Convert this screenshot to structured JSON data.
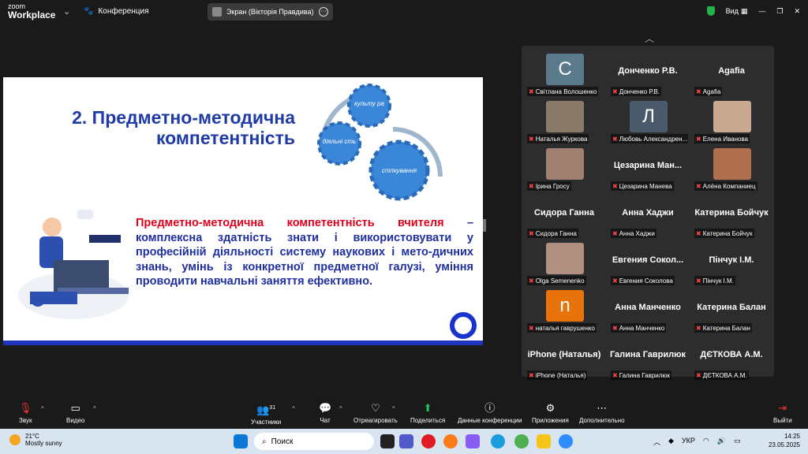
{
  "topbar": {
    "brand_small": "zoom",
    "brand_big": "Workplace",
    "conference": "Конференция",
    "screen_title": "Экран (Вікторія Правдива)",
    "view": "Вид"
  },
  "slide": {
    "title1": "2. Предметно-методична",
    "title2": "компетентність",
    "gear1": "культу ра",
    "gear2": "діяльні сть",
    "gear3": "спілкування",
    "def_red": "Предметно-методична компетентність вчителя",
    "def_rest": " – комплексна здатність знати і використовувати у професійній діяльності систему наукових і мето-дичних знань, умінь із конкретної предметної галузі, уміння проводити навчальні заняття ефективно."
  },
  "participants": [
    {
      "big": "",
      "name": "Світлана Волошенко",
      "avatar": "С",
      "color": "#5b7a8c"
    },
    {
      "big": "Донченко Р.В.",
      "name": "Донченко Р.В."
    },
    {
      "big": "Agafia",
      "name": "Agafia"
    },
    {
      "big": "",
      "name": "Наталья Журкова",
      "photo": "#8a7a6a"
    },
    {
      "big": "",
      "name": "Любовь Александрен...",
      "avatar": "Л",
      "color": "#4a5a6a"
    },
    {
      "big": "",
      "name": "Елена Иванова",
      "photo": "#c8a890"
    },
    {
      "big": "",
      "name": "Ірина Гросу",
      "photo": "#a08070"
    },
    {
      "big": "Цезарина Ман...",
      "name": "Цезарина Манева"
    },
    {
      "big": "",
      "name": "Алёна Компаниец",
      "photo": "#b07050"
    },
    {
      "big": "Сидора Ганна",
      "name": "Сидора Ганна"
    },
    {
      "big": "Анна Хаджи",
      "name": "Анна Хаджи"
    },
    {
      "big": "Катерина Бойчук",
      "name": "Катерина Бойчук"
    },
    {
      "big": "",
      "name": "Olga Semenenko",
      "photo": "#b09080"
    },
    {
      "big": "Евгения Сокол...",
      "name": "Евгения Соколова"
    },
    {
      "big": "Пінчук І.М.",
      "name": "Пінчук І.М."
    },
    {
      "big": "",
      "name": "наталья гаврушенко",
      "avatar": "n",
      "color": "#e8720c"
    },
    {
      "big": "Анна Манченко",
      "name": "Анна Манченко"
    },
    {
      "big": "Катерина Балан",
      "name": "Катерина Балан"
    },
    {
      "big": "iPhone (Наталья)",
      "name": "iPhone (Наталья)"
    },
    {
      "big": "Галина Гаврилюк",
      "name": "Галина Гаврилюк"
    },
    {
      "big": "ДЄТКОВА А.М.",
      "name": "ДЄТКОВА А.М."
    }
  ],
  "toolbar": {
    "audio": "Звук",
    "video": "Видео",
    "participants": "Участники",
    "participants_count": "31",
    "chat": "Чат",
    "react": "Отреагировать",
    "share": "Поделиться",
    "info": "Данные конференции",
    "apps": "Приложения",
    "more": "Дополнительно",
    "leave": "Выйти"
  },
  "taskbar": {
    "temp": "21°C",
    "weather": "Mostly sunny",
    "search": "Поиск",
    "lang": "УКР",
    "time": "14:25",
    "date": "23.05.2025"
  }
}
